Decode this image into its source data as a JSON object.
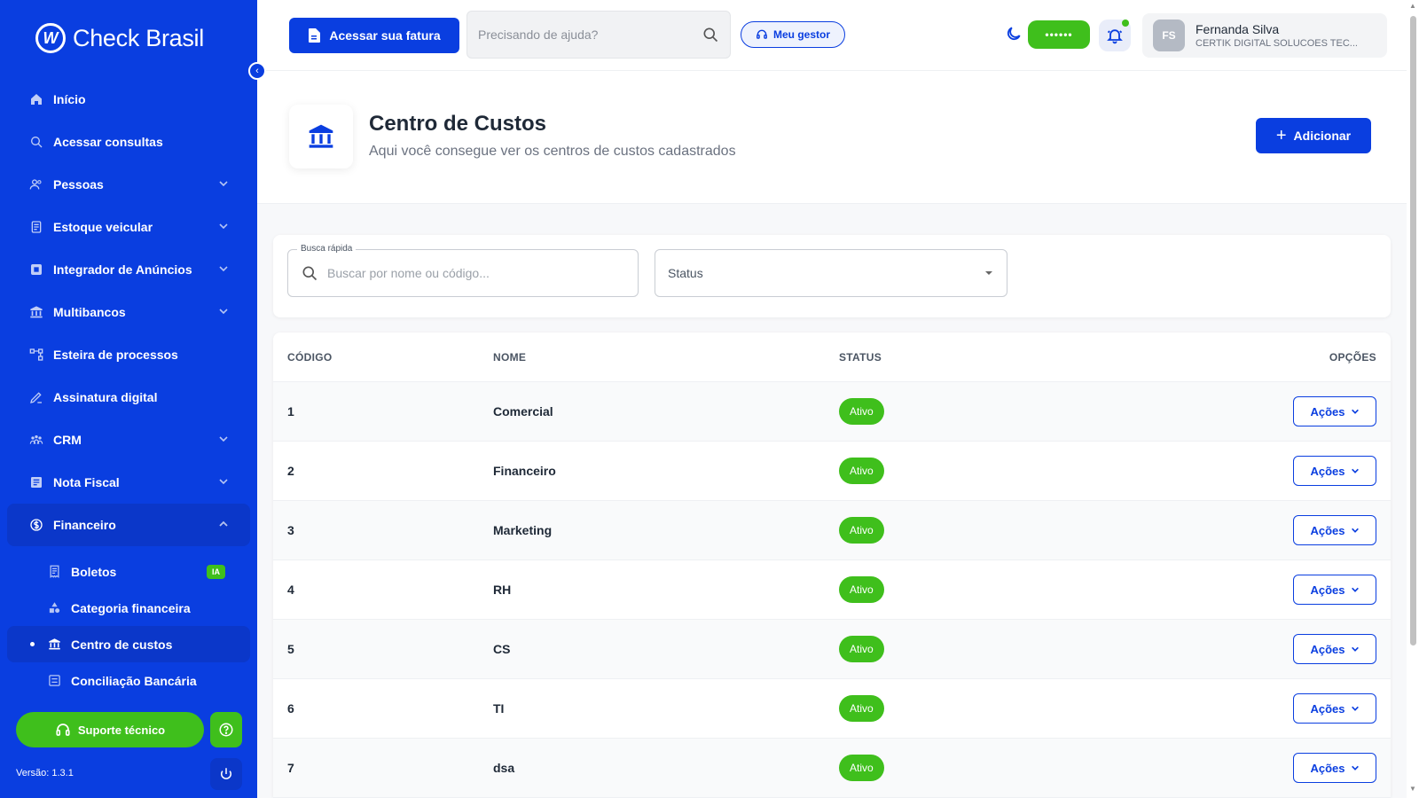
{
  "brand": {
    "name": "Check Brasil"
  },
  "sidebar": {
    "items": [
      {
        "label": "Início",
        "icon": "home-icon",
        "chevron": false
      },
      {
        "label": "Acessar consultas",
        "icon": "search-icon",
        "chevron": false
      },
      {
        "label": "Pessoas",
        "icon": "people-icon",
        "chevron": true
      },
      {
        "label": "Estoque veicular",
        "icon": "car-icon",
        "chevron": true
      },
      {
        "label": "Integrador de Anúncios",
        "icon": "ads-icon",
        "chevron": true
      },
      {
        "label": "Multibancos",
        "icon": "bank-icon",
        "chevron": true
      },
      {
        "label": "Esteira de processos",
        "icon": "flow-icon",
        "chevron": false
      },
      {
        "label": "Assinatura digital",
        "icon": "signature-icon",
        "chevron": false
      },
      {
        "label": "CRM",
        "icon": "crm-icon",
        "chevron": true
      },
      {
        "label": "Nota Fiscal",
        "icon": "invoice-icon",
        "chevron": true
      },
      {
        "label": "Financeiro",
        "icon": "finance-icon",
        "chevron": true,
        "open": true
      }
    ],
    "sub_items": [
      {
        "label": "Boletos",
        "icon": "receipt-icon",
        "badge": "IA"
      },
      {
        "label": "Categoria financeira",
        "icon": "shapes-icon"
      },
      {
        "label": "Centro de custos",
        "icon": "bank-icon",
        "active": true
      },
      {
        "label": "Conciliação Bancária",
        "icon": "reconcile-icon"
      }
    ],
    "support_label": "Suporte técnico",
    "version": "Versão: 1.3.1"
  },
  "header": {
    "invoice_button": "Acessar sua fatura",
    "help_placeholder": "Precisando de ajuda?",
    "manager_button": "Meu gestor",
    "balance_masked": "••••••",
    "user": {
      "initials": "FS",
      "name": "Fernanda Silva",
      "company": "CERTIK DIGITAL SOLUCOES TEC..."
    }
  },
  "page": {
    "title": "Centro de Custos",
    "subtitle": "Aqui você consegue ver os centros de custos cadastrados",
    "add_button": "Adicionar"
  },
  "filters": {
    "quick_search_label": "Busca rápida",
    "quick_search_placeholder": "Buscar por nome ou código...",
    "status_placeholder": "Status"
  },
  "table": {
    "headers": {
      "code": "CÓDIGO",
      "name": "NOME",
      "status": "STATUS",
      "options": "OPÇÕES"
    },
    "actions_label": "Ações",
    "rows": [
      {
        "code": "1",
        "name": "Comercial",
        "status": "Ativo"
      },
      {
        "code": "2",
        "name": "Financeiro",
        "status": "Ativo"
      },
      {
        "code": "3",
        "name": "Marketing",
        "status": "Ativo"
      },
      {
        "code": "4",
        "name": "RH",
        "status": "Ativo"
      },
      {
        "code": "5",
        "name": "CS",
        "status": "Ativo"
      },
      {
        "code": "6",
        "name": "TI",
        "status": "Ativo"
      },
      {
        "code": "7",
        "name": "dsa",
        "status": "Ativo"
      }
    ]
  },
  "colors": {
    "primary": "#0a3ee0",
    "success": "#3fbf1c"
  }
}
